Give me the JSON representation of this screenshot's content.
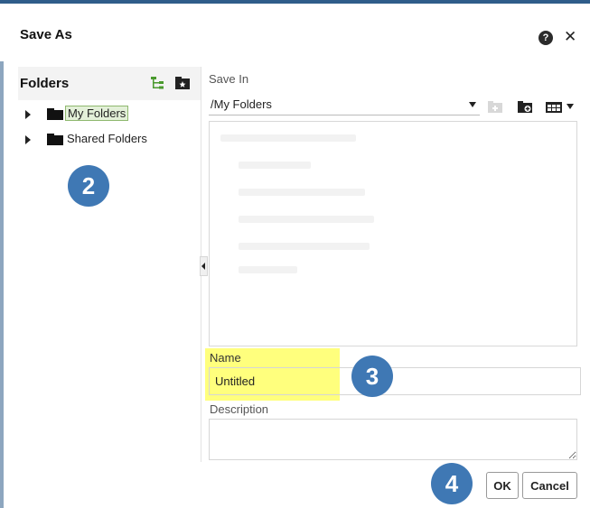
{
  "dialog": {
    "title": "Save As",
    "help_icon": "help-icon",
    "close_icon": "close-icon",
    "close_glyph": "✕",
    "help_glyph": "?"
  },
  "folders_panel": {
    "title": "Folders",
    "icons": [
      "folder-tree-icon",
      "new-folder-icon"
    ],
    "items": [
      {
        "label": "My Folders",
        "selected": true
      },
      {
        "label": "Shared Folders",
        "selected": false
      }
    ]
  },
  "save_in": {
    "label": "Save In",
    "value": "/My Folders",
    "toolbar_icons": [
      "new-folder-disabled-icon",
      "new-folder-icon",
      "view-grid-icon"
    ]
  },
  "name": {
    "label": "Name",
    "value": "Untitled"
  },
  "description": {
    "label": "Description",
    "value": ""
  },
  "buttons": {
    "ok": "OK",
    "cancel": "Cancel"
  },
  "callouts": [
    "2",
    "3",
    "4"
  ],
  "colors": {
    "accent": "#3f78b4",
    "highlight": "#ffff66",
    "selected_item": "#e3f0d8"
  }
}
